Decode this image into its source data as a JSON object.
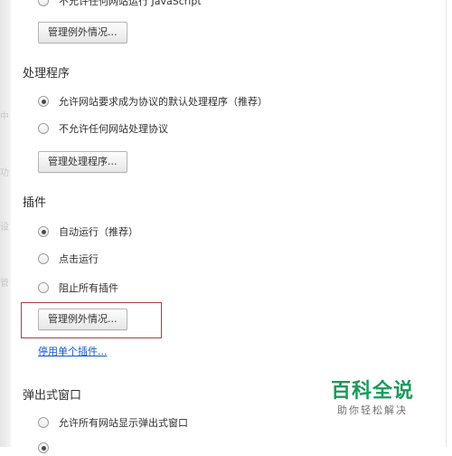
{
  "javascript": {
    "option_block_all": "不允许任何网站运行 JavaScript",
    "manage_exceptions_label": "管理例外情况..."
  },
  "handlers": {
    "title": "处理程序",
    "options": [
      {
        "label": "允许网站要求成为协议的默认处理程序（推荐）",
        "checked": true
      },
      {
        "label": "不允许任何网站处理协议",
        "checked": false
      }
    ],
    "manage_handlers_label": "管理处理程序..."
  },
  "plugins": {
    "title": "插件",
    "options": [
      {
        "label": "自动运行（推荐）",
        "checked": true
      },
      {
        "label": "点击运行",
        "checked": false
      },
      {
        "label": "阻止所有插件",
        "checked": false
      }
    ],
    "manage_exceptions_label": "管理例外情况...",
    "disable_individual_link": "停用单个插件..."
  },
  "popups": {
    "title": "弹出式窗口",
    "options": [
      {
        "label": "允许所有网站显示弹出式窗口",
        "checked": false
      }
    ]
  },
  "watermark": {
    "title": "百科全说",
    "subtitle": "助你轻松解决",
    "color": "#1a9a5a"
  },
  "colors": {
    "link": "#1155cc",
    "highlight_border": "#b43c3c"
  }
}
